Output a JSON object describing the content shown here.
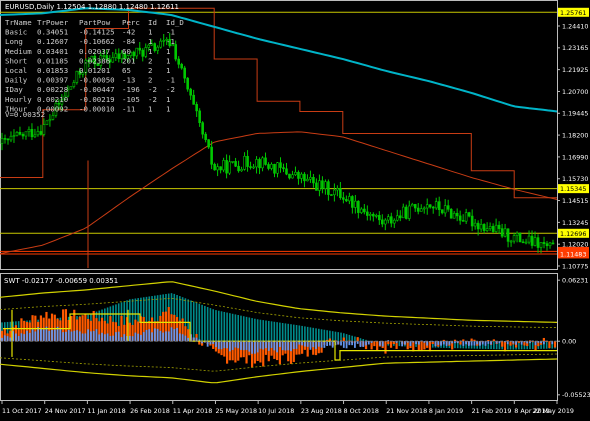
{
  "window": {
    "main_header": "EURUSD,Daily  1.12504 1.12880 1.12480 1.12611",
    "sub_header": "SWT -0.02177 -0.00659 0.00351"
  },
  "stats_table": {
    "headers": [
      "TrName",
      "TrPower",
      "PartPow",
      "Perc",
      "Id",
      "Id_D"
    ],
    "rows": [
      [
        "Basic",
        "0.34051",
        "-0.14125",
        "-42",
        "1",
        "-1"
      ],
      [
        "Long",
        "0.12607",
        "-0.10662",
        "-84",
        "1",
        "-1"
      ],
      [
        "Medium",
        "0.03401",
        "0.02037",
        "60",
        "1",
        "1"
      ],
      [
        "Short",
        "0.01185",
        "0.02386",
        "201",
        "2",
        "1"
      ],
      [
        "Local",
        "0.01853",
        "0.01201",
        "65",
        "2",
        "1"
      ],
      [
        "Daily",
        "0.00397",
        "-0.00050",
        "-13",
        "2",
        "-1"
      ],
      [
        "IDay",
        "0.00228",
        "-0.00447",
        "-196",
        "-2",
        "-2"
      ],
      [
        "Hourly",
        "0.00210",
        "-0.00219",
        "-105",
        "-2",
        "1"
      ],
      [
        "IHour",
        "0.00092",
        "-0.00010",
        "-11",
        "1",
        "1"
      ]
    ],
    "footer": "V=0.00352"
  },
  "chart_data": [
    {
      "type": "line",
      "name": "main_price",
      "series": [
        {
          "name": "EURUSD close",
          "color": "#00b400",
          "x": [
            "11 Oct 2017",
            "24 Nov 2017",
            "11 Jan 2018",
            "26 Feb 2018",
            "11 Apr 2018",
            "25 May 2018",
            "10 Jul 2018",
            "23 Aug 2018",
            "8 Oct 2018",
            "21 Nov 2018",
            "8 Jan 2019",
            "21 Feb 2019",
            "8 Apr 2019",
            "22 May 2019"
          ],
          "values": [
            1.18,
            1.19,
            1.228,
            1.232,
            1.24,
            1.165,
            1.17,
            1.16,
            1.15,
            1.133,
            1.145,
            1.135,
            1.125,
            1.118
          ]
        },
        {
          "name": "MA cyan",
          "color": "#00b4c8",
          "values": [
            1.256,
            1.257,
            1.26,
            1.259,
            1.256,
            1.249,
            1.242,
            1.236,
            1.23,
            1.223,
            1.217,
            1.21,
            1.202,
            1.199
          ]
        },
        {
          "name": "MA brown",
          "color": "#c83c14",
          "values": [
            1.115,
            1.12,
            1.13,
            1.148,
            1.165,
            1.181,
            1.186,
            1.187,
            1.184,
            1.176,
            1.168,
            1.16,
            1.153,
            1.147
          ]
        },
        {
          "name": "step level",
          "color": "#c83c14",
          "values": [
            1.16,
            1.2,
            1.248,
            1.26,
            1.26,
            1.23,
            1.205,
            1.199,
            1.186,
            1.186,
            1.186,
            1.164,
            1.148,
            1.148
          ]
        }
      ],
      "hlines": [
        {
          "value": 1.2576,
          "color": "#c8c800"
        },
        {
          "value": 1.1534,
          "color": "#c8c800"
        },
        {
          "value": 1.127,
          "color": "#c8c800"
        },
        {
          "value": 1.1163,
          "color": "#ff3c00"
        },
        {
          "value": 1.1148,
          "color": "#ff3c00"
        }
      ],
      "price_tags": [
        {
          "label": "1.25761",
          "value": 1.2576,
          "bg": "#ffff00",
          "fg": "#000"
        },
        {
          "label": "1.15345",
          "value": 1.1534,
          "bg": "#ffff00",
          "fg": "#000"
        },
        {
          "label": "1.12696",
          "value": 1.127,
          "bg": "#ffff00",
          "fg": "#000"
        },
        {
          "label": "1.11628",
          "value": 1.1163,
          "bg": "#ff3c00",
          "fg": "#fff"
        },
        {
          "label": "1.11483",
          "value": 1.1148,
          "bg": "#ff3c00",
          "fg": "#fff"
        }
      ],
      "y_ticks": [
        "1.24410",
        "1.23165",
        "1.21925",
        "1.20700",
        "1.19445",
        "1.18200",
        "1.16990",
        "1.15730",
        "1.14515",
        "1.13245",
        "1.12020",
        "1.10775"
      ],
      "ylim": [
        1.1065,
        1.2625
      ]
    },
    {
      "type": "area",
      "name": "swt_oscillator",
      "y_ticks": [
        "0.06231",
        "0.00",
        "-0.05523"
      ],
      "ylim": [
        -0.05523,
        0.06231
      ],
      "x_labels": [
        "11 Oct 2017",
        "24 Nov 2017",
        "11 Jan 2018",
        "26 Feb 2018",
        "11 Apr 2018",
        "25 May 2018",
        "10 Jul 2018",
        "23 Aug 2018",
        "8 Oct 2018",
        "21 Nov 2018",
        "8 Jan 2019",
        "21 Feb 2019",
        "8 Apr 2019",
        "22 May 2019"
      ],
      "series": [
        {
          "name": "teal",
          "color": "#008c8c",
          "values": [
            0.018,
            0.021,
            0.025,
            0.04,
            0.046,
            0.03,
            0.021,
            0.015,
            0.008,
            -0.004,
            -0.006,
            -0.007,
            -0.008,
            -0.007
          ]
        },
        {
          "name": "orange",
          "color": "#ff5a00",
          "values": [
            0.01,
            0.026,
            0.024,
            0.018,
            0.028,
            -0.014,
            -0.02,
            -0.015,
            0.004,
            -0.006,
            -0.004,
            -0.003,
            -0.005,
            -0.002
          ]
        },
        {
          "name": "cornflower",
          "color": "#6495ed",
          "values": [
            0.005,
            0.012,
            0.01,
            0.006,
            0.012,
            -0.006,
            -0.01,
            -0.006,
            -0.004,
            -0.002,
            -0.002,
            -0.002,
            -0.002,
            -0.001
          ]
        },
        {
          "name": "yellow upper band",
          "color": "#d2d200",
          "values": [
            0.042,
            0.046,
            0.049,
            0.053,
            0.057,
            0.048,
            0.038,
            0.031,
            0.027,
            0.024,
            0.022,
            0.02,
            0.019,
            0.018
          ]
        },
        {
          "name": "yellow lower band",
          "color": "#d2d200",
          "values": [
            -0.022,
            -0.026,
            -0.03,
            -0.033,
            -0.035,
            -0.04,
            -0.034,
            -0.029,
            -0.025,
            -0.021,
            -0.02,
            -0.019,
            -0.018,
            -0.017
          ]
        }
      ]
    }
  ]
}
